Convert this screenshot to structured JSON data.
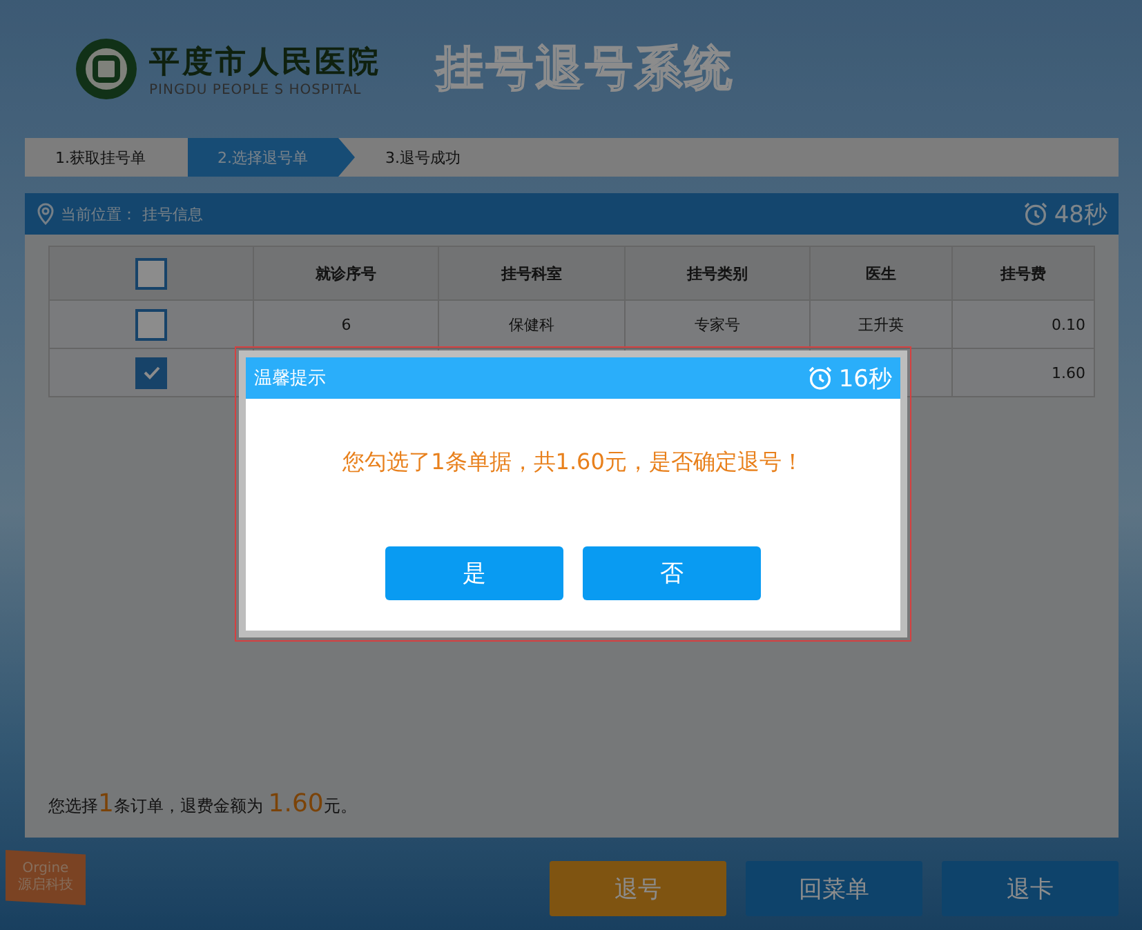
{
  "header": {
    "hospital_name": "平度市人民医院",
    "hospital_name_en": "PINGDU PEOPLE S HOSPITAL",
    "system_title": "挂号退号系统"
  },
  "steps": [
    {
      "label": "1.获取挂号单",
      "selected": false
    },
    {
      "label": "2.选择退号单",
      "selected": true
    },
    {
      "label": "3.退号成功",
      "selected": false
    }
  ],
  "location_bar": {
    "label": "当前位置：",
    "value": "挂号信息",
    "countdown": "48秒"
  },
  "table": {
    "header_checked": false,
    "columns": [
      "就诊序号",
      "挂号科室",
      "挂号类别",
      "医生",
      "挂号费"
    ],
    "rows": [
      {
        "checked": false,
        "cells": [
          "6",
          "保健科",
          "专家号",
          "王升英",
          "0.10"
        ]
      },
      {
        "checked": true,
        "cells": [
          null,
          null,
          null,
          null,
          "1.60"
        ]
      }
    ]
  },
  "summary": "您选择**1**条订单，退费金额为 **1.60**元。",
  "buttons": [
    {
      "label": "退号",
      "kind": "warning"
    },
    {
      "label": "回菜单",
      "kind": "normal"
    },
    {
      "label": "退卡",
      "kind": "normal"
    }
  ],
  "brand_flag": {
    "name": "Orgine",
    "subtitle": "源启科技"
  },
  "dialog": {
    "title": "温馨提示",
    "countdown": "16秒",
    "message": "您勾选了1条单据，共1.60元，是否确定退号！",
    "buttons": [
      "是",
      "否"
    ]
  }
}
